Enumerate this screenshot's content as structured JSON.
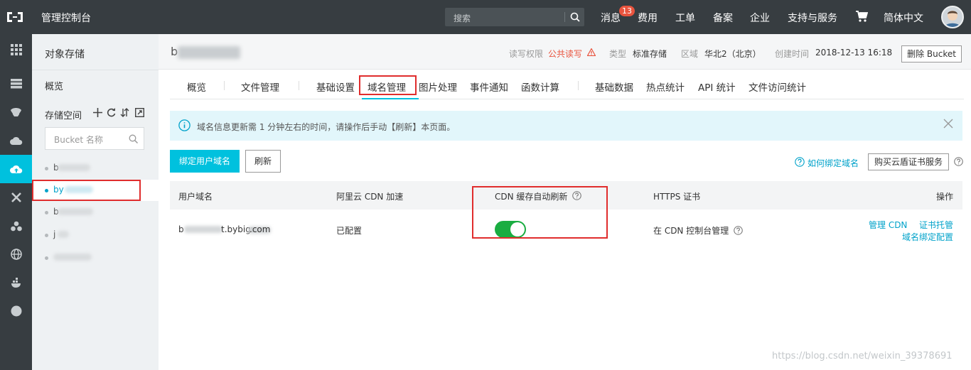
{
  "topbar": {
    "brand": "管理控制台",
    "search_placeholder": "搜索",
    "nav": [
      "消息",
      "费用",
      "工单",
      "备案",
      "企业",
      "支持与服务",
      "简体中文"
    ],
    "message_badge": "13"
  },
  "sidebar": {
    "title": "对象存储",
    "overview": "概览",
    "buckets_header": "存储空间",
    "bucket_search_placeholder": "Bucket 名称",
    "buckets": [
      "b",
      "by",
      "b",
      "j",
      ""
    ]
  },
  "header": {
    "bucket_name": "b",
    "acl_label": "读写权限",
    "acl_value": "公共读写",
    "type_label": "类型",
    "type_value": "标准存储",
    "region_label": "区域",
    "region_value": "华北2（北京）",
    "created_label": "创建时间",
    "created_value": "2018-12-13 16:18",
    "delete_button": "删除 Bucket"
  },
  "tabs": [
    "概览",
    "文件管理",
    "基础设置",
    "域名管理",
    "图片处理",
    "事件通知",
    "函数计算",
    "基础数据",
    "热点统计",
    "API 统计",
    "文件访问统计"
  ],
  "active_tab": "域名管理",
  "notice": "域名信息更新需 1 分钟左右的时间，请操作后手动【刷新】本页面。",
  "actions": {
    "bind_domain": "绑定用户域名",
    "refresh": "刷新",
    "how_to_bind": "如何绑定域名",
    "buy_cert": "购买云盾证书服务"
  },
  "table": {
    "columns": [
      "用户域名",
      "阿里云 CDN 加速",
      "CDN 缓存自动刷新",
      "HTTPS 证书",
      "操作"
    ],
    "rows": [
      {
        "domain_prefix": "b",
        "domain_mid": "t.bybigu",
        "domain_suffix": ".com",
        "cdn": "已配置",
        "auto_refresh_on": true,
        "https": "在 CDN 控制台管理",
        "op_manage_cdn": "管理 CDN",
        "op_cert": "证书托管",
        "op_domain_config": "域名绑定配置"
      }
    ]
  },
  "watermark": "https://blog.csdn.net/weixin_39378691",
  "colors": {
    "topbar": "#373d41",
    "accent": "#00c1de",
    "link": "#00a2ca",
    "toggle_on": "#1aad41",
    "warning": "#e9543e",
    "highlight_box": "#e02d2d"
  }
}
